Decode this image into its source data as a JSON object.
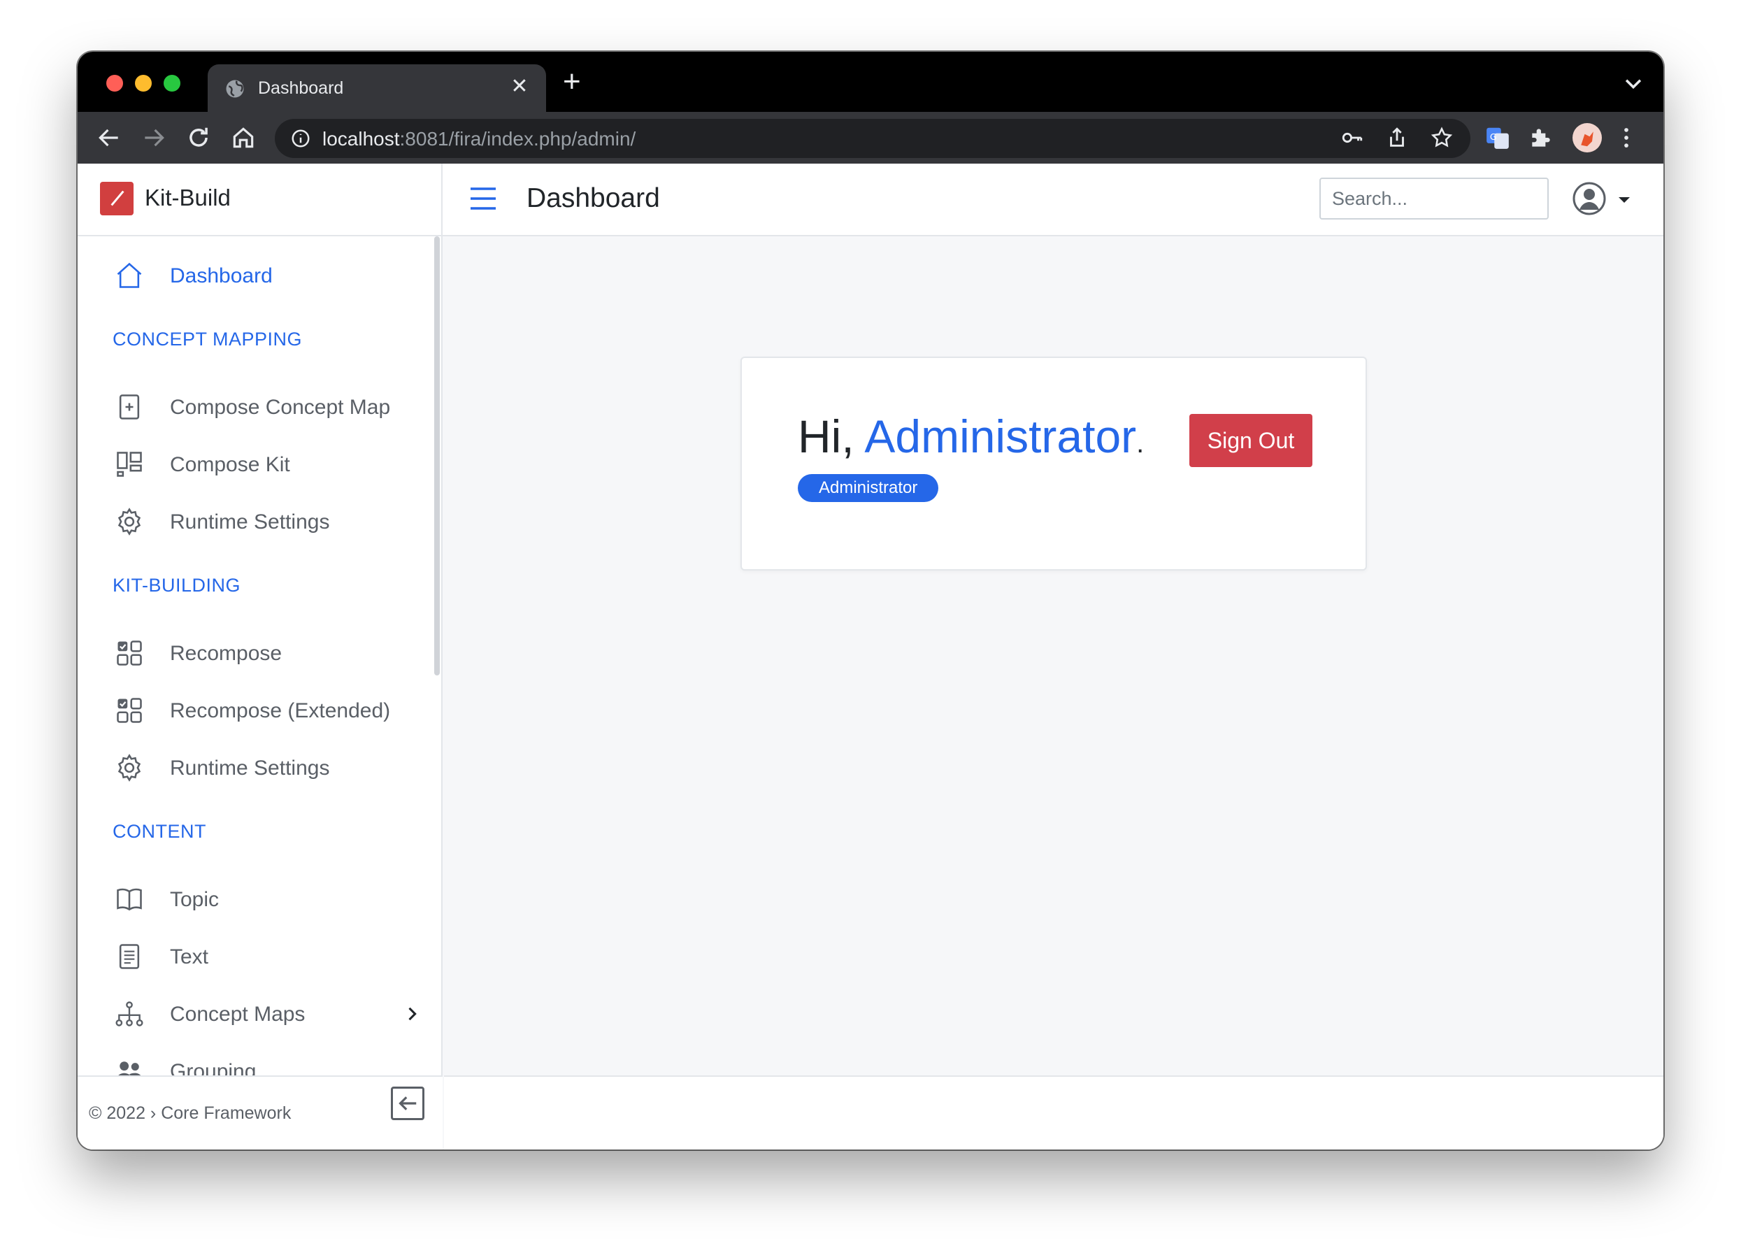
{
  "browser": {
    "tab_title": "Dashboard",
    "new_tab_symbol": "+",
    "close_symbol": "✕",
    "url_host": "localhost",
    "url_rest": ":8081/fira/index.php/admin/"
  },
  "brand": {
    "name": "Kit-Build"
  },
  "sidebar": {
    "dashboard": "Dashboard",
    "sections": {
      "concept_mapping": "CONCEPT MAPPING",
      "kit_building": "KIT-BUILDING",
      "content": "CONTENT"
    },
    "concept_mapping_items": [
      "Compose Concept Map",
      "Compose Kit",
      "Runtime Settings"
    ],
    "kit_building_items": [
      "Recompose",
      "Recompose (Extended)",
      "Runtime Settings"
    ],
    "content_items": [
      "Topic",
      "Text",
      "Concept Maps",
      "Grouping"
    ],
    "footer": "© 2022 › Core Framework"
  },
  "header": {
    "title": "Dashboard",
    "search_placeholder": "Search..."
  },
  "card": {
    "greeting": "Hi, ",
    "user_name": "Administrator",
    "punct": ".",
    "role_badge": "Administrator",
    "sign_out": "Sign Out"
  },
  "colors": {
    "accent": "#2567e8",
    "danger": "#d13f4a",
    "brand": "#d13f3f"
  }
}
